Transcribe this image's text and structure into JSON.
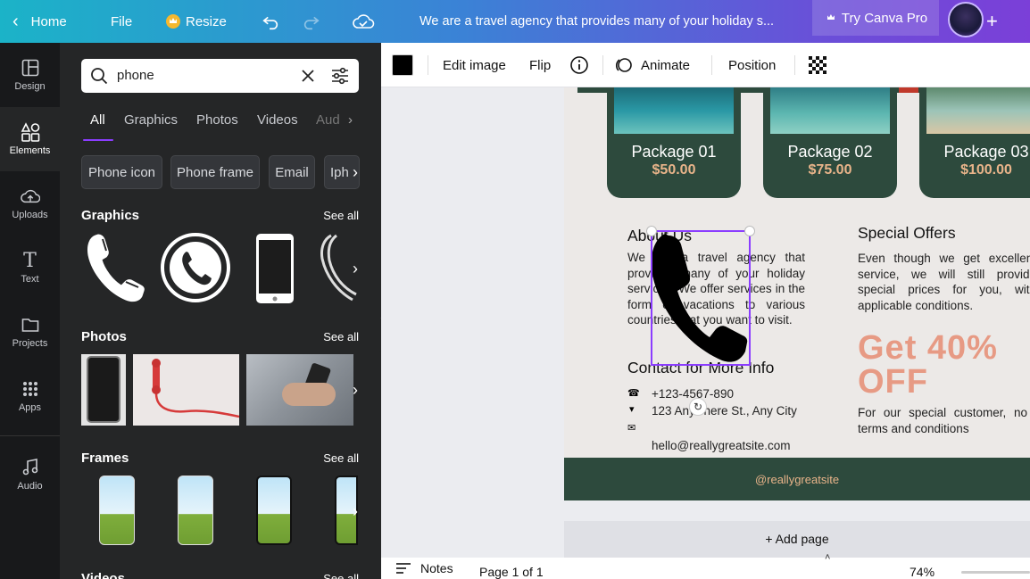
{
  "topbar": {
    "home_label": "Home",
    "file_label": "File",
    "resize_label": "Resize",
    "doc_title": "We are a travel agency that provides many of your holiday s...",
    "try_pro_label": "Try Canva Pro",
    "share_add": "+"
  },
  "rail": {
    "items": [
      {
        "label": "Design",
        "icon": "layout-icon"
      },
      {
        "label": "Elements",
        "icon": "shapes-icon"
      },
      {
        "label": "Uploads",
        "icon": "cloud-upload-icon"
      },
      {
        "label": "Text",
        "icon": "text-icon"
      },
      {
        "label": "Projects",
        "icon": "folder-icon"
      },
      {
        "label": "Apps",
        "icon": "grid-icon"
      },
      {
        "label": "Audio",
        "icon": "music-note-icon"
      }
    ]
  },
  "panel": {
    "search_value": "phone",
    "tabs": [
      "All",
      "Graphics",
      "Photos",
      "Videos",
      "Aud"
    ],
    "chips": [
      "Phone icon",
      "Phone frame",
      "Email",
      "Iph"
    ],
    "sections": {
      "graphics": "Graphics",
      "photos": "Photos",
      "frames": "Frames",
      "videos": "Videos"
    },
    "see_all": "See all"
  },
  "toolbar": {
    "edit_image": "Edit image",
    "flip": "Flip",
    "animate": "Animate",
    "position": "Position"
  },
  "design": {
    "packages": [
      {
        "name": "Package 01",
        "price": "$50.00"
      },
      {
        "name": "Package 02",
        "price": "$75.00"
      },
      {
        "name": "Package 03",
        "price": "$100.00"
      }
    ],
    "about_title": "About Us",
    "about_text": "We are a travel agency that provides many of your holiday services. We offer services in the form of vacations to various countries that you want to visit.",
    "contact_title": "Contact for More Info",
    "contact_phone": "+123-4567-890",
    "contact_address": "123 Anywhere St., Any City",
    "contact_email": "hello@reallygreatsite.com",
    "offers_title": "Special Offers",
    "offers_text": "Even though we get excellent service, we will still provide special prices for you, with applicable conditions.",
    "offer_big": "Get 40% OFF",
    "offer_note": "For our special customer, no terms and conditions",
    "footer_handle": "@reallygreatsite",
    "add_page": "+ Add page"
  },
  "status": {
    "notes_label": "Notes",
    "page_label": "Page 1 of 1",
    "zoom": "74%"
  },
  "colors": {
    "accent": "#8b3dff",
    "dark_green": "#2d4a3d",
    "salmon": "#e79a84",
    "gold": "#e9b48a"
  }
}
